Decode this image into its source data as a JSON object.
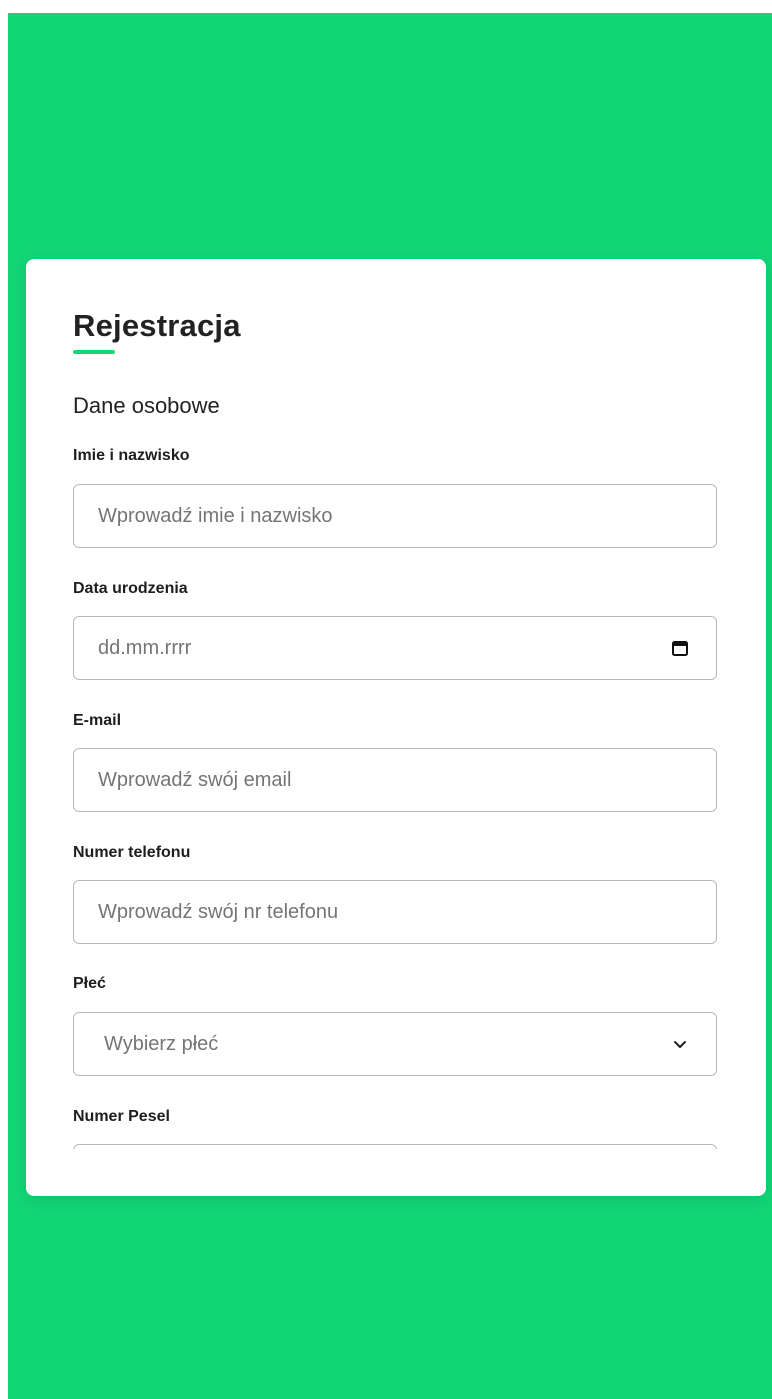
{
  "form": {
    "title": "Rejestracja",
    "section_title": "Dane osobowe",
    "fields": {
      "full_name": {
        "label": "Imie i nazwisko",
        "placeholder": "Wprowadź imie i nazwisko"
      },
      "birth_date": {
        "label": "Data urodzenia",
        "placeholder": "dd.mm.rrrr",
        "icon": "calendar-icon"
      },
      "email": {
        "label": "E-mail",
        "placeholder": "Wprowadź swój email"
      },
      "phone": {
        "label": "Numer telefonu",
        "placeholder": "Wprowadź swój nr telefonu"
      },
      "gender": {
        "label": "Płeć",
        "selected": "Wybierz płeć",
        "icon": "chevron-down-icon"
      },
      "pesel": {
        "label": "Numer Pesel",
        "placeholder": ""
      }
    }
  },
  "colors": {
    "accent": "#12d576",
    "text": "#222222",
    "placeholder": "#757575",
    "border": "#b8b8b8"
  }
}
